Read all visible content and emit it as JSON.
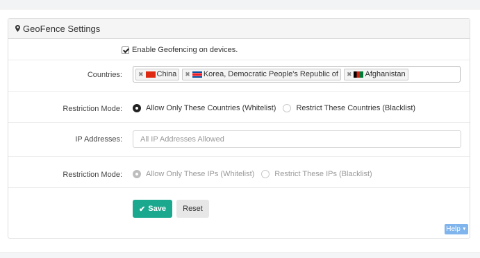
{
  "panel": {
    "title": "GeoFence Settings",
    "title_icon": "map-marker-icon"
  },
  "enable": {
    "label": "Enable Geofencing on devices.",
    "checked": true
  },
  "countries": {
    "label": "Countries:",
    "tags": [
      {
        "name": "China",
        "flag_color": "#de2910"
      },
      {
        "name": "Korea, Democratic People's Republic of",
        "flag_color": "#024fa2"
      },
      {
        "name": "Afghanistan",
        "flag_color": "#007a36"
      }
    ]
  },
  "country_restriction": {
    "label": "Restriction Mode:",
    "options": [
      "Allow Only These Countries (Whitelist)",
      "Restrict These Countries (Blacklist)"
    ],
    "selected": "Allow Only These Countries (Whitelist)"
  },
  "ip": {
    "label": "IP Addresses:",
    "placeholder": "All IP Addresses Allowed",
    "value": ""
  },
  "ip_restriction": {
    "label": "Restriction Mode:",
    "options": [
      "Allow Only These IPs (Whitelist)",
      "Restrict These IPs (Blacklist)"
    ],
    "selected": "Allow Only These IPs (Whitelist)",
    "disabled": true
  },
  "actions": {
    "save": "Save",
    "reset": "Reset",
    "help": "Help"
  },
  "colors": {
    "save_bg": "#1aa88f",
    "help_bg": "#7fb4ec"
  }
}
